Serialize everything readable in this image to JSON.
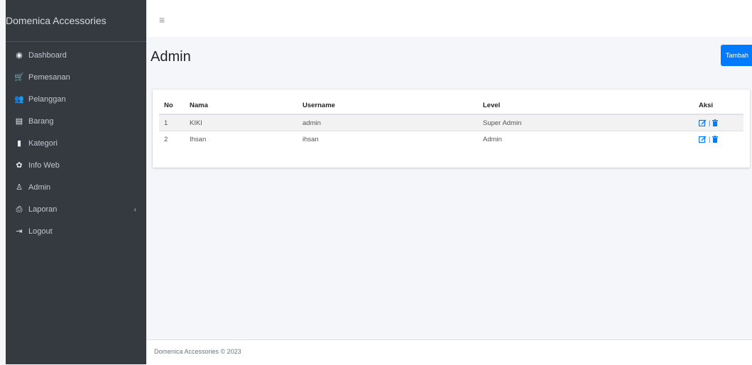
{
  "sidebar": {
    "brand": "Domenica Accessories",
    "items": [
      {
        "label": "Dashboard",
        "icon": "dashboard-icon",
        "glyph": "◉"
      },
      {
        "label": "Pemesanan",
        "icon": "cart-icon",
        "glyph": "🛒"
      },
      {
        "label": "Pelanggan",
        "icon": "users-icon",
        "glyph": "👥"
      },
      {
        "label": "Barang",
        "icon": "box-icon",
        "glyph": "▤"
      },
      {
        "label": "Kategori",
        "icon": "file-icon",
        "glyph": "▮"
      },
      {
        "label": "Info Web",
        "icon": "gear-icon",
        "glyph": "✿"
      },
      {
        "label": "Admin",
        "icon": "user-icon",
        "glyph": "♙"
      },
      {
        "label": "Laporan",
        "icon": "printer-icon",
        "glyph": "⎙",
        "chevron": "‹"
      },
      {
        "label": "Logout",
        "icon": "logout-icon",
        "glyph": "⇥"
      }
    ]
  },
  "topbar": {
    "menu_icon": "≡"
  },
  "main": {
    "title": "Admin",
    "add_button_label": "Tambah",
    "table": {
      "headers": [
        "No",
        "Nama",
        "Username",
        "Level",
        "Aksi"
      ],
      "rows": [
        {
          "no": "1",
          "nama": "KIKI",
          "username": "admin",
          "level": "Super Admin"
        },
        {
          "no": "2",
          "nama": "Ihsan",
          "username": "ihsan",
          "level": "Admin"
        }
      ],
      "action_separator": "|"
    }
  },
  "footer": {
    "text": "Domenica Accessories © 2023"
  },
  "colors": {
    "primary": "#007bff",
    "sidebar": "#343a40",
    "background": "#f4f6f9"
  }
}
